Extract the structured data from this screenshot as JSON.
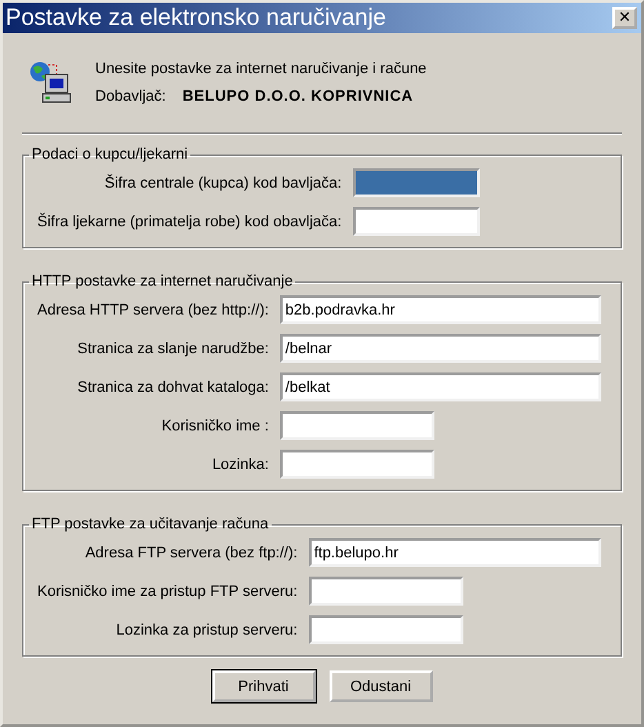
{
  "window": {
    "title": "Postavke za elektronsko naručivanje",
    "close": "✕"
  },
  "header": {
    "intro": "Unesite postavke za internet naručivanje i račune",
    "supplier_label": "Dobavljač:",
    "supplier": "BELUPO D.O.O. KOPRIVNICA"
  },
  "groups": [
    {
      "title": "Podaci o kupcu/ljekarni",
      "fields": [
        {
          "label": "Šifra centrale (kupca) kod bavljača:",
          "kind": "medium",
          "selected": true
        },
        {
          "label": "Šifra ljekarne (primatelja robe) kod obavljača:",
          "kind": "medium",
          "selected": false
        }
      ]
    },
    {
      "title": "HTTP postavke za internet naručivanje",
      "fields": [
        {
          "label": "Adresa HTTP servera (bez http://):",
          "value": "b2b.podravka.hr",
          "kind": "wide",
          "selected": false
        },
        {
          "label": "Stranica za slanje narudžbe:",
          "value": "/belnar",
          "kind": "wide",
          "selected": false
        },
        {
          "label": "Stranica za dohvat kataloga:",
          "value": "/belkat",
          "kind": "wide",
          "selected": false
        },
        {
          "label": "Korisničko ime :",
          "kind": "short",
          "selected": false
        },
        {
          "label": "Lozinka:",
          "kind": "short",
          "selected": false
        }
      ]
    },
    {
      "title": "FTP postavke za učitavanje računa",
      "fields": [
        {
          "label": "Adresa FTP servera (bez ftp://):",
          "value": "ftp.belupo.hr",
          "kind": "wide",
          "selected": false
        },
        {
          "label": "Korisničko ime za pristup FTP serveru:",
          "kind": "short",
          "selected": false
        },
        {
          "label": "Lozinka za pristup serveru:",
          "kind": "short",
          "selected": false
        }
      ]
    }
  ],
  "buttons": [
    {
      "label": "Prihvati",
      "default": true
    },
    {
      "label": "Odustani",
      "default": false
    }
  ]
}
